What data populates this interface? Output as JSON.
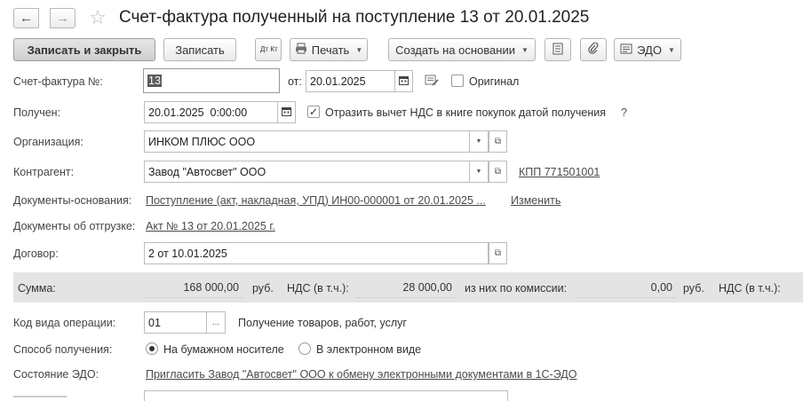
{
  "window": {
    "title": "Счет-фактура полученный на поступление 13 от 20.01.2025"
  },
  "toolbar": {
    "save_close": "Записать и закрыть",
    "save": "Записать",
    "dt_kt": "Дт Кт",
    "print": "Печать",
    "create_based": "Создать на основании",
    "edo": "ЭДО"
  },
  "form": {
    "invoice_number_label": "Счет-фактура №:",
    "invoice_number": "13",
    "from_label": "от:",
    "from_date": "20.01.2025",
    "original_label": "Оригинал",
    "original_checked": false,
    "received_label": "Получен:",
    "received_datetime": "20.01.2025  0:00:00",
    "vat_reflect_label": "Отразить вычет НДС в книге покупок датой получения",
    "vat_reflect_checked": true,
    "help": "?",
    "organization_label": "Организация:",
    "organization": "ИНКОМ ПЛЮС ООО",
    "counterparty_label": "Контрагент:",
    "counterparty": "Завод \"Автосвет\" ООО",
    "kpp_link": "КПП 771501001",
    "base_docs_label": "Документы-основания:",
    "base_docs_link": "Поступление (акт, накладная, УПД) ИН00-000001 от 20.01.2025 ...",
    "change_link": "Изменить",
    "shipment_docs_label": "Документы об отгрузке:",
    "shipment_docs_link": "Акт № 13 от 20.01.2025 г.",
    "contract_label": "Договор:",
    "contract": "2 от 10.01.2025",
    "sum_label": "Сумма:",
    "sum_value": "168 000,00",
    "rub1": "руб.",
    "vat_label": "НДС (в т.ч.):",
    "vat_value": "28 000,00",
    "commission_label": "из них по комиссии:",
    "commission_value": "0,00",
    "rub2": "руб.",
    "vat_label2": "НДС (в т.ч.):",
    "op_code_label": "Код вида операции:",
    "op_code": "01",
    "op_code_desc": "Получение товаров, работ, услуг",
    "receive_method_label": "Способ получения:",
    "paper_label": "На бумажном носителе",
    "electronic_label": "В электронном виде",
    "receive_method_selected": "paper",
    "edo_state_label": "Состояние ЭДО:",
    "edo_state_link": "Пригласить Завод \"Автосвет\" ООО к обмену электронными документами в 1С-ЭДО"
  }
}
